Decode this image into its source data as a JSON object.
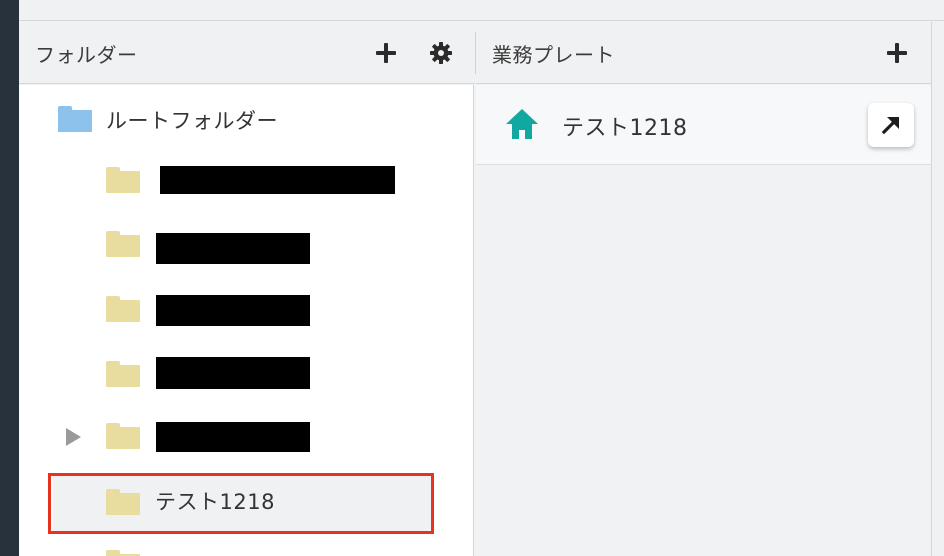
{
  "folder_panel": {
    "title": "フォルダー",
    "add_icon": "plus-icon",
    "settings_icon": "gear-icon",
    "tree": [
      {
        "label": "ルートフォルダー",
        "folder_color": "#8cc2ec",
        "redacted": false,
        "expandable": false
      },
      {
        "label": "",
        "folder_color": "#e8dc9f",
        "redacted": true,
        "expandable": false
      },
      {
        "label": "",
        "folder_color": "#e8dc9f",
        "redacted": true,
        "expandable": false
      },
      {
        "label": "",
        "folder_color": "#e8dc9f",
        "redacted": true,
        "expandable": false
      },
      {
        "label": "",
        "folder_color": "#e8dc9f",
        "redacted": true,
        "expandable": false
      },
      {
        "label": "",
        "folder_color": "#e8dc9f",
        "redacted": true,
        "expandable": true
      },
      {
        "label": "テスト1218",
        "folder_color": "#e8dc9f",
        "redacted": false,
        "expandable": false,
        "selected": true
      }
    ]
  },
  "plate_panel": {
    "title": "業務プレート",
    "add_icon": "plus-icon",
    "items": [
      {
        "label": "テスト1218",
        "icon": "home-icon",
        "icon_color": "#11a8a1",
        "action_icon": "arrow-up-right-icon"
      }
    ]
  },
  "colors": {
    "highlight": "#e8321e",
    "rail": "#27323d"
  }
}
